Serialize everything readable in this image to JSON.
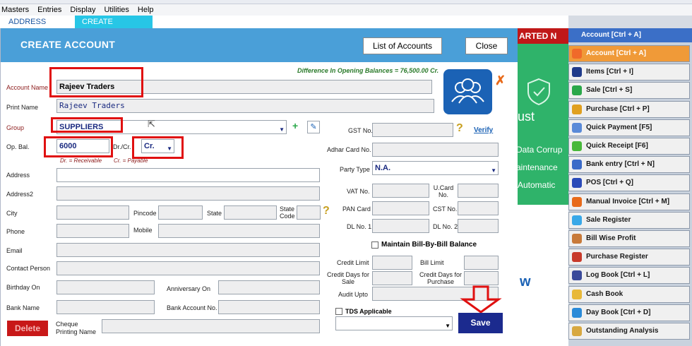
{
  "menu": [
    "Masters",
    "Entries",
    "Display",
    "Utilities",
    "Help"
  ],
  "tabs": {
    "address_book": "ADDRESS BOOK",
    "create_account": "CREATE ACCOUNT"
  },
  "dialog": {
    "title": "CREATE ACCOUNT",
    "list_button": "List of Accounts",
    "close_button": "Close",
    "difference_note": "Difference In Opening Balances = 76,500.00 Cr.",
    "delete_button": "Delete",
    "save_button": "Save"
  },
  "labels": {
    "account_name": "Account Name",
    "print_name": "Print Name",
    "group": "Group",
    "op_bal": "Op. Bal.",
    "drcr": "Dr./Cr.",
    "dr_hint": "Dr. = Receivable",
    "cr_hint": "Cr. = Payable",
    "address": "Address",
    "address2": "Address2",
    "city": "City",
    "pincode": "Pincode",
    "state": "State",
    "state_code": "State Code",
    "phone": "Phone",
    "mobile": "Mobile",
    "email": "Email",
    "contact_person": "Contact Person",
    "birthday": "Birthday On",
    "anniversary": "Anniversary On",
    "bank_name": "Bank Name",
    "bank_account": "Bank Account No.",
    "cheque_name": "Cheque Printing Name",
    "gst": "GST No.",
    "verify": "Verify",
    "adhar": "Adhar Card No.",
    "party_type": "Party Type",
    "vat": "VAT No.",
    "ucard": "U.Card No.",
    "pan": "PAN Card",
    "cst": "CST No.",
    "dl1": "DL No. 1",
    "dl2": "DL No. 2",
    "bill_by_bill": "Maintain Bill-By-Bill Balance",
    "credit_limit": "Credit Limit",
    "bill_limit": "Bill Limit",
    "credit_days_sale": "Credit Days for Sale",
    "credit_days_purchase": "Credit Days for Purchase",
    "audit_upto": "Audit Upto",
    "tds": "TDS Applicable"
  },
  "values": {
    "account_name": "Rajeev Traders",
    "print_name": "Rajeev Traders",
    "group": "SUPPLIERS",
    "op_bal": "6000",
    "drcr": "Cr.",
    "party_type": "N.A."
  },
  "side_banner": {
    "top_text": "ARTED N",
    "line1": "ust",
    "line2": "Data Corrup",
    "line3": "aintenance",
    "line4": "Automatic",
    "line5": "w"
  },
  "sidebar": {
    "header": "Account [Ctrl + A]",
    "items": [
      {
        "label": "Account [Ctrl + A]",
        "icon": "#f06a2a"
      },
      {
        "label": "Items [Ctrl + I]",
        "icon": "#1f3a8a"
      },
      {
        "label": "Sale [Ctrl + S]",
        "icon": "#2aa84a"
      },
      {
        "label": "Purchase [Ctrl + P]",
        "icon": "#e0a020"
      },
      {
        "label": "Quick Payment [F5]",
        "icon": "#5a8ad8"
      },
      {
        "label": "Quick Receipt [F6]",
        "icon": "#48b83a"
      },
      {
        "label": "Bank entry [Ctrl + N]",
        "icon": "#3a6ac8"
      },
      {
        "label": "POS [Ctrl + Q]",
        "icon": "#2a4ab8"
      },
      {
        "label": "Manual Invoice [Ctrl + M]",
        "icon": "#e86a1a"
      },
      {
        "label": "Sale Register",
        "icon": "#38a8e8"
      },
      {
        "label": "Bill Wise Profit",
        "icon": "#c87a3a"
      },
      {
        "label": "Purchase Register",
        "icon": "#c83a2a"
      },
      {
        "label": "Log Book [Ctrl + L]",
        "icon": "#3a4a9a"
      },
      {
        "label": "Cash Book",
        "icon": "#e8b838"
      },
      {
        "label": "Day Book [Ctrl + D]",
        "icon": "#2a8ad8"
      },
      {
        "label": "Outstanding Analysis",
        "icon": "#d8a840"
      }
    ]
  }
}
